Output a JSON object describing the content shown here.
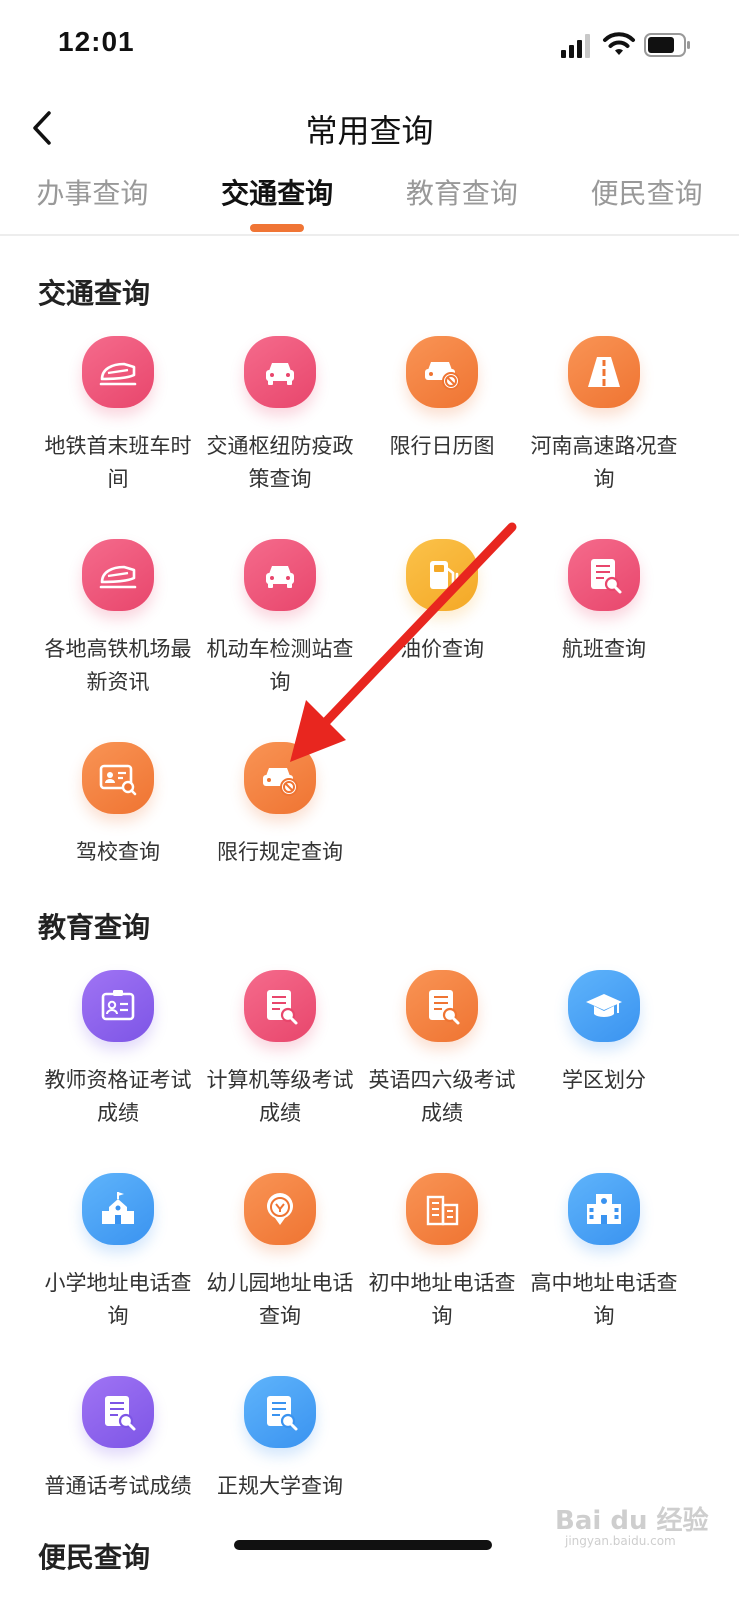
{
  "status_bar": {
    "time": "12:01"
  },
  "header": {
    "title": "常用查询"
  },
  "tabs": [
    {
      "label": "办事查询",
      "active": false
    },
    {
      "label": "交通查询",
      "active": true
    },
    {
      "label": "教育查询",
      "active": false
    },
    {
      "label": "便民查询",
      "active": false
    }
  ],
  "traffic": {
    "title": "交通查询",
    "items": [
      {
        "label": "地铁首末班车时间",
        "icon": "train-icon",
        "color": "#ec5578"
      },
      {
        "label": "交通枢纽防疫政策查询",
        "icon": "car-icon",
        "color": "#ec5578"
      },
      {
        "label": "限行日历图",
        "icon": "car-restricted-icon",
        "color": "#f27d3a"
      },
      {
        "label": "河南高速路况查询",
        "icon": "highway-icon",
        "color": "#f27d3a"
      },
      {
        "label": "各地高铁机场最新资讯",
        "icon": "train-icon",
        "color": "#ec5578"
      },
      {
        "label": "机动车检测站查询",
        "icon": "car-icon",
        "color": "#ec5578"
      },
      {
        "label": "油价查询",
        "icon": "fuel-pump-icon",
        "color": "#f6b02e"
      },
      {
        "label": "航班查询",
        "icon": "document-search-icon",
        "color": "#ec5578"
      },
      {
        "label": "驾校查询",
        "icon": "id-card-search-icon",
        "color": "#f27d3a"
      },
      {
        "label": "限行规定查询",
        "icon": "car-restricted-icon",
        "color": "#f27d3a"
      }
    ]
  },
  "education": {
    "title": "教育查询",
    "items": [
      {
        "label": "教师资格证考试成绩",
        "icon": "id-badge-icon",
        "color": "#8a60ec"
      },
      {
        "label": "计算机等级考试成绩",
        "icon": "document-search-icon",
        "color": "#ec5578"
      },
      {
        "label": "英语四六级考试成绩",
        "icon": "document-search-icon",
        "color": "#f27d3a"
      },
      {
        "label": "学区划分",
        "icon": "graduation-cap-icon",
        "color": "#4aa2f5"
      },
      {
        "label": "小学地址电话查询",
        "icon": "school-icon",
        "color": "#4aa2f5"
      },
      {
        "label": "幼儿园地址电话查询",
        "icon": "kindergarten-icon",
        "color": "#f27d3a"
      },
      {
        "label": "初中地址电话查询",
        "icon": "building-icon",
        "color": "#f27d3a"
      },
      {
        "label": "高中地址电话查询",
        "icon": "building-icon",
        "color": "#4aa2f5"
      },
      {
        "label": "普通话考试成绩",
        "icon": "document-search-icon",
        "color": "#8a60ec"
      },
      {
        "label": "正规大学查询",
        "icon": "document-search-icon",
        "color": "#4aa2f5"
      }
    ]
  },
  "convenience": {
    "title": "便民查询"
  },
  "watermark": {
    "brand": "Bai du 经验",
    "url": "jingyan.baidu.com"
  },
  "annotation": {
    "color": "#e8261f"
  }
}
